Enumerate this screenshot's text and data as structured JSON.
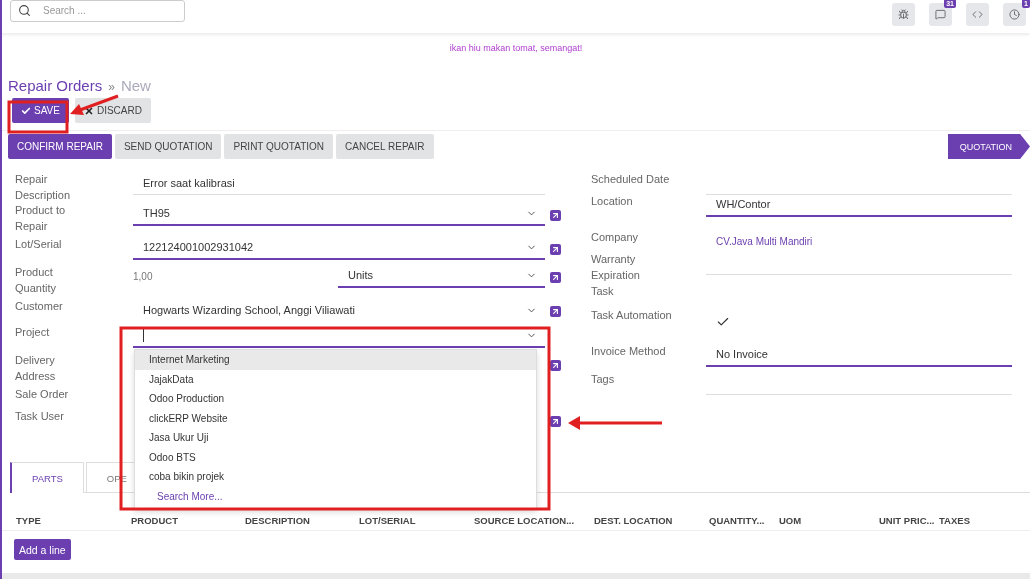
{
  "topbar": {
    "search": {
      "placeholder": "Search ..."
    },
    "icons": [
      {
        "kind": "debug"
      },
      {
        "kind": "chat",
        "badge": "31"
      },
      {
        "kind": "code"
      },
      {
        "kind": "activity",
        "badge": "1"
      }
    ]
  },
  "message": "ikan hiu makan tomat, semangat!",
  "breadcrumb": {
    "parent": "Repair Orders",
    "separator": "»",
    "current": "New"
  },
  "form_buttons": [
    {
      "label": "SAVE",
      "kind": "primary"
    },
    {
      "label": "DISCARD",
      "kind": "secondary"
    }
  ],
  "actions": [
    {
      "label": "CONFIRM REPAIR",
      "kind": "primary"
    },
    {
      "label": "SEND QUOTATION",
      "kind": "secondary"
    },
    {
      "label": "PRINT QUOTATION",
      "kind": "secondary"
    },
    {
      "label": "CANCEL REPAIR",
      "kind": "secondary"
    }
  ],
  "stages": [
    {
      "label": "QUOTATION",
      "selected": true
    }
  ],
  "left_fields": [
    {
      "label": "Repair Description",
      "kind": "text",
      "value": "Error saat kalibrasi"
    },
    {
      "label": "Product to Repair",
      "kind": "select",
      "value": "TH95"
    },
    {
      "label": "Lot/Serial",
      "kind": "select",
      "value": "122124001002931042"
    },
    {
      "label": "Product Quantity",
      "kind": "quantity",
      "value": "1,00",
      "unit": "Units"
    },
    {
      "label": "Customer",
      "kind": "select_open",
      "value": "Hogwarts Wizarding School, Anggi Viliawati"
    },
    {
      "label": "Project",
      "kind": "focused"
    },
    {
      "label": "Delivery Address",
      "kind": "link_only"
    },
    {
      "label": "Sale Order",
      "kind": "empty"
    },
    {
      "label": "Task User",
      "kind": "link_only"
    }
  ],
  "right_fields": [
    {
      "label": "Scheduled Date",
      "kind": "text"
    },
    {
      "label": "Location",
      "kind": "select",
      "value": "WH/Contor"
    },
    {
      "label": "Company",
      "kind": "link",
      "value": "CV.Java Multi Mandiri"
    },
    {
      "label": "Warranty Expiration",
      "kind": "text"
    },
    {
      "label": "Task",
      "kind": "empty"
    },
    {
      "label": "Task Automation",
      "kind": "checkbox",
      "checked": true
    },
    {
      "label": "Invoice Method",
      "kind": "select",
      "value": "No Invoice"
    },
    {
      "label": "Tags",
      "kind": "text"
    }
  ],
  "project_dropdown": {
    "items": [
      {
        "label": "Internet Marketing",
        "selected": true
      },
      {
        "label": "JajakData",
        "selected": false
      },
      {
        "label": "Odoo Production",
        "selected": false
      },
      {
        "label": "clickERP Website",
        "selected": false
      },
      {
        "label": "Jasa Ukur Uji",
        "selected": false
      },
      {
        "label": "Odoo BTS",
        "selected": false
      },
      {
        "label": "coba bikin projek",
        "selected": false
      }
    ],
    "search_more": "Search More..."
  },
  "tabs": [
    {
      "label": "PARTS",
      "selected": true
    },
    {
      "label": "OPE",
      "selected": false
    }
  ],
  "table": {
    "columns": [
      "TYPE",
      "PRODUCT",
      "DESCRIPTION",
      "LOT/SERIAL",
      "SOURCE LOCATION...",
      "DEST. LOCATION",
      "QUANTITY...",
      "UOM",
      "UNIT PRIC...",
      "TAXES"
    ]
  },
  "add_line": "Add a line"
}
